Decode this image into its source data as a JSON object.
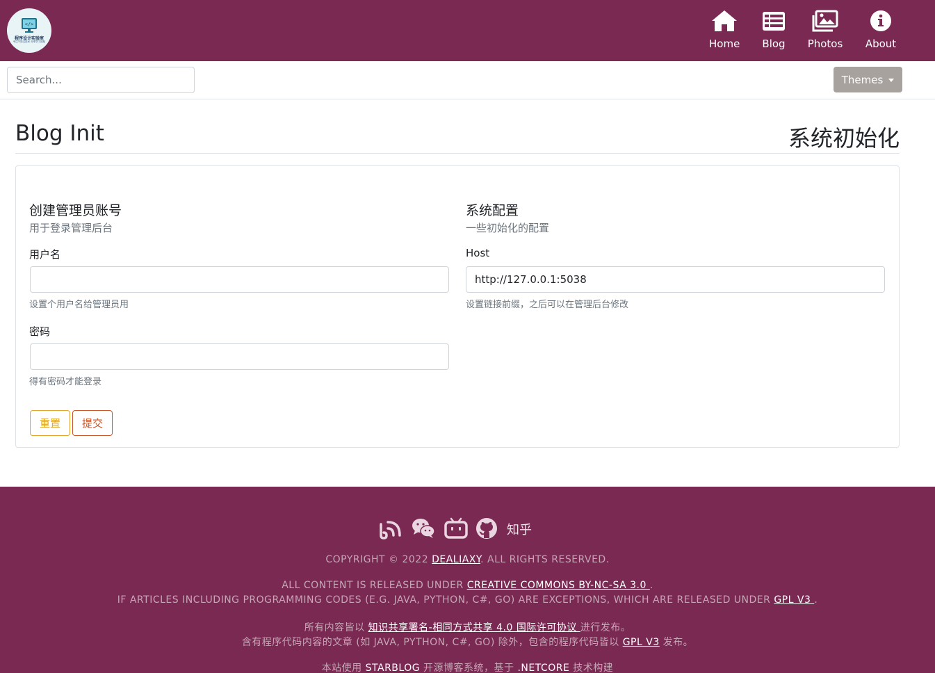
{
  "nav": {
    "logo_text": "程序设计实验室",
    "logo_subtext": "专注于前沿技术 分享学习经验",
    "items": [
      {
        "label": "Home",
        "icon": "home-icon"
      },
      {
        "label": "Blog",
        "icon": "list-icon"
      },
      {
        "label": "Photos",
        "icon": "photos-icon"
      },
      {
        "label": "About",
        "icon": "info-icon"
      }
    ]
  },
  "toolbar": {
    "search_placeholder": "Search...",
    "themes_label": "Themes"
  },
  "page": {
    "title": "Blog Init",
    "subtitle": "系统初始化"
  },
  "admin": {
    "title": "创建管理员账号",
    "subtitle": "用于登录管理后台",
    "username_label": "用户名",
    "username_value": "",
    "username_help": "设置个用户名给管理员用",
    "password_label": "密码",
    "password_value": "",
    "password_help": "得有密码才能登录"
  },
  "config": {
    "title": "系统配置",
    "subtitle": "一些初始化的配置",
    "host_label": "Host",
    "host_value": "http://127.0.0.1:5038",
    "host_help": "设置链接前缀，之后可以在管理后台修改"
  },
  "buttons": {
    "reset": "重置",
    "submit": "提交"
  },
  "footer": {
    "zhihu": "知乎",
    "copyright_prefix": "COPYRIGHT © 2022 ",
    "copyright_author": "DEALIAXY",
    "copyright_suffix": ". ALL RIGHTS RESERVED.",
    "license_prefix": "ALL CONTENT IS RELEASED UNDER ",
    "license_link": "CREATIVE COMMONS BY-NC-SA 3.0 ",
    "license_suffix": ".",
    "code_prefix": "IF ARTICLES INCLUDING PROGRAMMING CODES (E.G. JAVA, PYTHON, C#, GO) ARE EXCEPTIONS, WHICH ARE RELEASED UNDER ",
    "code_link": "GPL V3 ",
    "code_suffix": ".",
    "cn_license_prefix": "所有内容皆以 ",
    "cn_license_link": "知识共享署名-相同方式共享 4.0 国际许可协议 ",
    "cn_license_suffix": "进行发布。",
    "cn_code_prefix": "含有程序代码内容的文章 (如 JAVA, PYTHON, C#, GO) 除外，包含的程序代码皆以 ",
    "cn_code_link": "GPL V3",
    "cn_code_suffix": " 发布。",
    "powered_prefix": "本站使用 ",
    "powered_link1": "STARBLOG",
    "powered_mid": " 开源博客系统，基于 ",
    "powered_link2": ".NETCORE",
    "powered_suffix": " 技术构建"
  },
  "colors": {
    "brand": "#7a2953",
    "themes_button": "#a8a29e",
    "reset_button": "#e0a526",
    "submit_button": "#c9552a"
  }
}
